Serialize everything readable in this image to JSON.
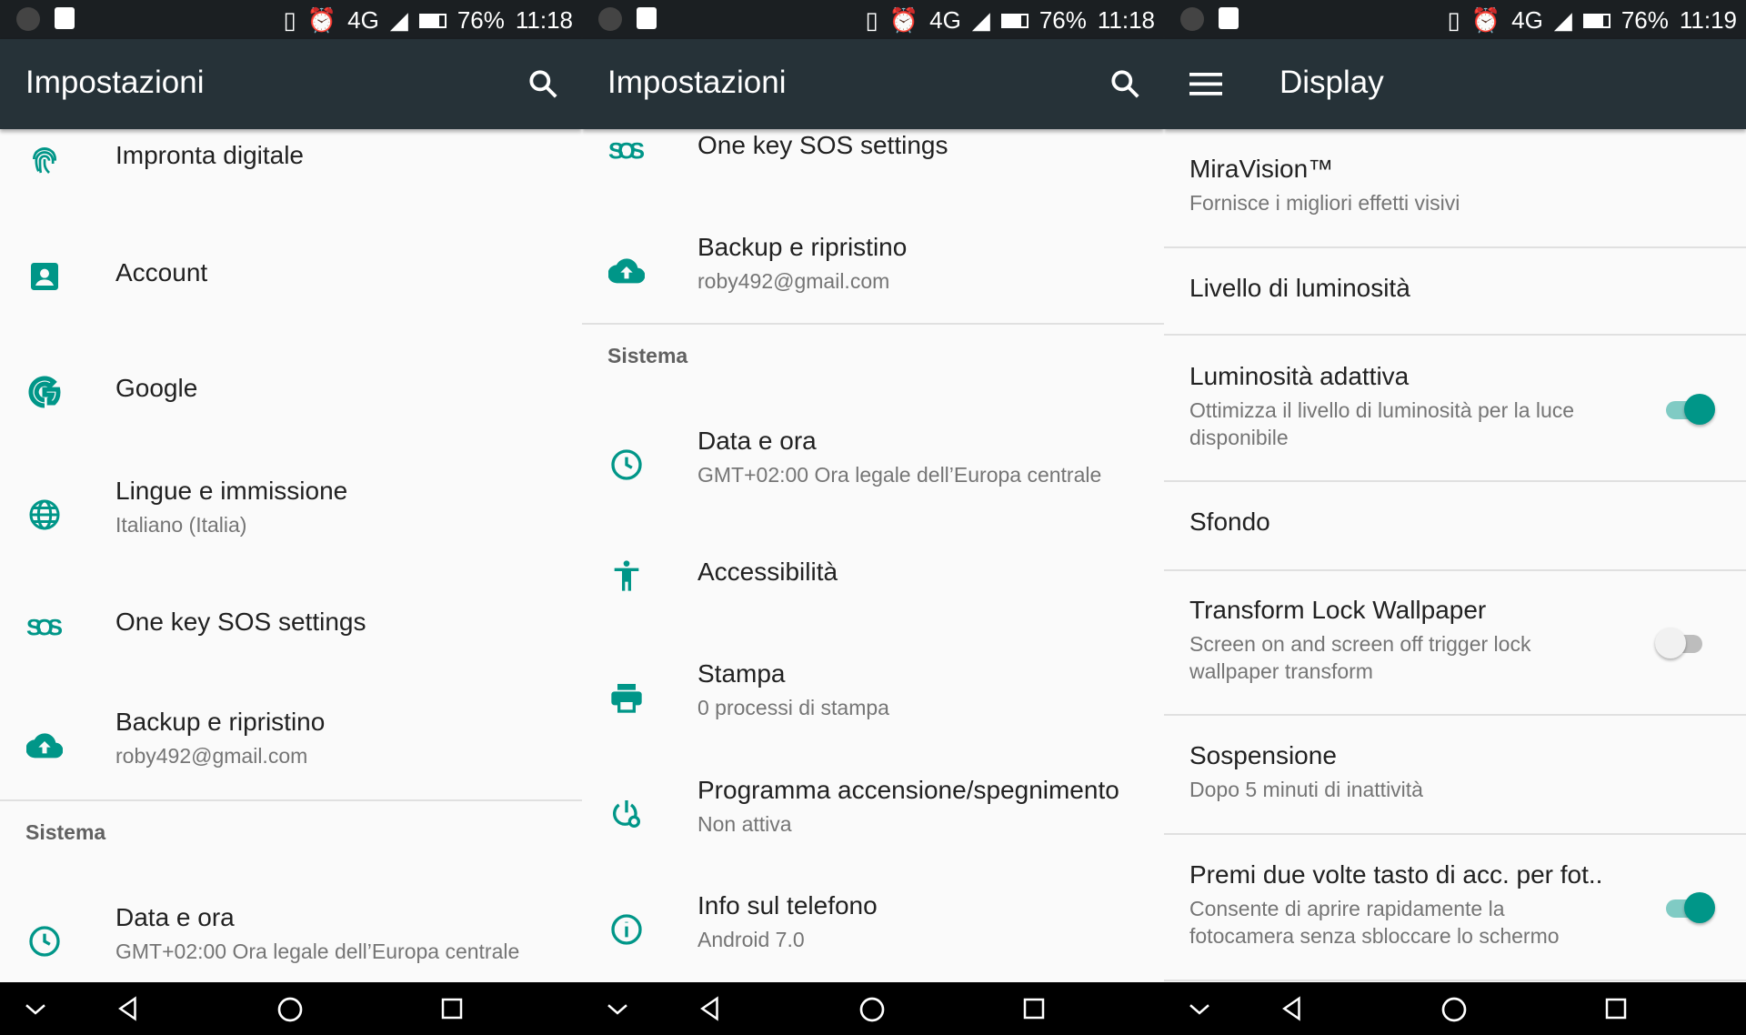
{
  "colors": {
    "accent": "#009688",
    "appbar": "#263238",
    "statusbar": "#1b1f22"
  },
  "panels": [
    {
      "status": {
        "network": "4G",
        "battery": "76%",
        "time": "11:18"
      },
      "title": "Impostazioni",
      "action_icon": "search-icon",
      "rows": [
        {
          "type": "item",
          "icon": "fingerprint-icon",
          "title": "Impronta digitale"
        },
        {
          "type": "item",
          "icon": "account-icon",
          "title": "Account"
        },
        {
          "type": "item",
          "icon": "google-icon",
          "title": "Google"
        },
        {
          "type": "item",
          "icon": "globe-icon",
          "title": "Lingue e immissione",
          "subtitle": "Italiano (Italia)"
        },
        {
          "type": "item",
          "icon": "sos-icon",
          "title": "One key SOS settings"
        },
        {
          "type": "item",
          "icon": "cloud-upload-icon",
          "title": "Backup e ripristino",
          "subtitle": "roby492@gmail.com"
        },
        {
          "type": "divider"
        },
        {
          "type": "category",
          "title": "Sistema"
        },
        {
          "type": "item",
          "icon": "clock-icon",
          "title": "Data e ora",
          "subtitle": "GMT+02:00 Ora legale dell’Europa centrale"
        }
      ]
    },
    {
      "status": {
        "network": "4G",
        "battery": "76%",
        "time": "11:18"
      },
      "title": "Impostazioni",
      "action_icon": "search-icon",
      "rows": [
        {
          "type": "item",
          "icon": "sos-icon",
          "title": "One key SOS settings"
        },
        {
          "type": "item",
          "icon": "cloud-upload-icon",
          "title": "Backup e ripristino",
          "subtitle": "roby492@gmail.com"
        },
        {
          "type": "divider"
        },
        {
          "type": "category",
          "title": "Sistema"
        },
        {
          "type": "item",
          "icon": "clock-icon",
          "title": "Data e ora",
          "subtitle": "GMT+02:00 Ora legale dell’Europa centrale"
        },
        {
          "type": "item",
          "icon": "accessibility-icon",
          "title": "Accessibilità"
        },
        {
          "type": "item",
          "icon": "printer-icon",
          "title": "Stampa",
          "subtitle": "0 processi di stampa"
        },
        {
          "type": "item",
          "icon": "power-schedule-icon",
          "title": "Programma accensione/spegnimento",
          "subtitle": "Non attiva"
        },
        {
          "type": "item",
          "icon": "info-icon",
          "title": "Info sul telefono",
          "subtitle": "Android 7.0"
        }
      ]
    },
    {
      "status": {
        "network": "4G",
        "battery": "76%",
        "time": "11:19"
      },
      "title": "Display",
      "action_icon": "menu-icon",
      "rows": [
        {
          "type": "item",
          "title": "MiraVision™",
          "subtitle": "Fornisce i migliori effetti visivi"
        },
        {
          "type": "divider"
        },
        {
          "type": "item",
          "title": "Livello di luminosità"
        },
        {
          "type": "divider"
        },
        {
          "type": "item",
          "title": "Luminosità adattiva",
          "subtitle": "Ottimizza il livello di luminosità per la luce\ndisponibile",
          "toggle": true
        },
        {
          "type": "divider"
        },
        {
          "type": "item",
          "title": "Sfondo"
        },
        {
          "type": "divider"
        },
        {
          "type": "item",
          "title": "Transform Lock Wallpaper",
          "subtitle": "Screen on and screen off trigger lock\nwallpaper transform",
          "toggle": false
        },
        {
          "type": "divider"
        },
        {
          "type": "item",
          "title": "Sospensione",
          "subtitle": "Dopo 5 minuti di inattività"
        },
        {
          "type": "divider"
        },
        {
          "type": "item",
          "title": "Premi due volte tasto di acc. per fot..",
          "subtitle": "Consente di aprire rapidamente la\nfotocamera senza sbloccare lo schermo",
          "toggle": true
        },
        {
          "type": "divider"
        }
      ]
    }
  ]
}
